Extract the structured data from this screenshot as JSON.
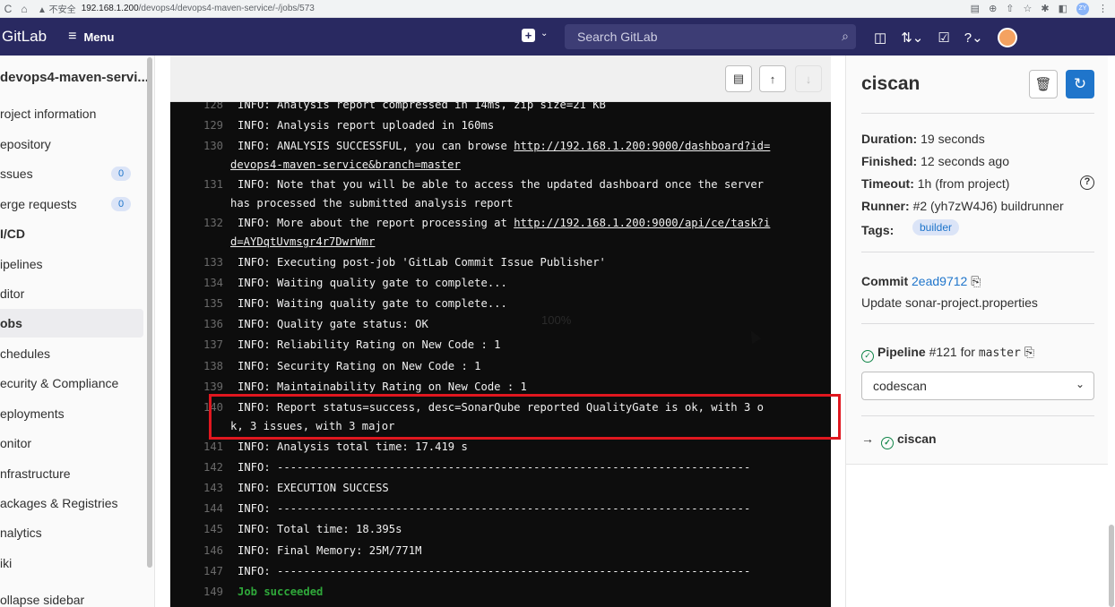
{
  "browser": {
    "nav_back": "C",
    "nav_home": "⌂",
    "security_label": "▲ 不安全",
    "url_host": "192.168.1.200",
    "url_path": "/devops4/devops4-maven-service/-/jobs/573",
    "profile": "ZY"
  },
  "topnav": {
    "brand": "GitLab",
    "menu_label": "Menu",
    "search_placeholder": "Search GitLab"
  },
  "sidebar": {
    "project": "devops4-maven-servi...",
    "items": [
      {
        "label": "roject information"
      },
      {
        "label": "epository"
      },
      {
        "label": "ssues",
        "badge": "0"
      },
      {
        "label": "erge requests",
        "badge": "0"
      },
      {
        "label": "I/CD"
      },
      {
        "label": "ipelines"
      },
      {
        "label": "ditor"
      },
      {
        "label": "obs"
      },
      {
        "label": "chedules"
      },
      {
        "label": "ecurity & Compliance"
      },
      {
        "label": "eployments"
      },
      {
        "label": "onitor"
      },
      {
        "label": "nfrastructure"
      },
      {
        "label": "ackages & Registries"
      },
      {
        "label": "nalytics"
      },
      {
        "label": "iki"
      }
    ],
    "collapse_label": "ollapse sidebar"
  },
  "log": {
    "watermark": "100%",
    "lines": [
      {
        "num": "128",
        "text": "INFO: Analysis report compressed in 14ms, zip size=21 KB"
      },
      {
        "num": "129",
        "text": "INFO: Analysis report uploaded in 160ms"
      },
      {
        "num": "130",
        "text": "INFO: ANALYSIS SUCCESSFUL, you can browse ",
        "link": "http://192.168.1.200:9000/dashboard?id=",
        "cont_link": "devops4-maven-service&branch=master"
      },
      {
        "num": "131",
        "text": "INFO: Note that you will be able to access the updated dashboard once the server",
        "cont": "has processed the submitted analysis report"
      },
      {
        "num": "132",
        "text": "INFO: More about the report processing at ",
        "link": "http://192.168.1.200:9000/api/ce/task?i",
        "cont_link": "d=AYDqtUvmsgr4r7DwrWmr"
      },
      {
        "num": "133",
        "text": "INFO: Executing post-job 'GitLab Commit Issue Publisher'"
      },
      {
        "num": "134",
        "text": "INFO: Waiting quality gate to complete..."
      },
      {
        "num": "135",
        "text": "INFO: Waiting quality gate to complete..."
      },
      {
        "num": "136",
        "text": "INFO: Quality gate status: OK"
      },
      {
        "num": "137",
        "text": "INFO: Reliability Rating on New Code : 1"
      },
      {
        "num": "138",
        "text": "INFO: Security Rating on New Code : 1"
      },
      {
        "num": "139",
        "text": "INFO: Maintainability Rating on New Code : 1"
      },
      {
        "num": "140",
        "text": "INFO: Report status=success, desc=SonarQube reported QualityGate is ok, with 3 o",
        "cont": "k, 3 issues, with 3 major"
      },
      {
        "num": "141",
        "text": "INFO: Analysis total time: 17.419 s"
      },
      {
        "num": "142",
        "text": "INFO: ------------------------------------------------------------------------"
      },
      {
        "num": "143",
        "text": "INFO: EXECUTION SUCCESS"
      },
      {
        "num": "144",
        "text": "INFO: ------------------------------------------------------------------------"
      },
      {
        "num": "145",
        "text": "INFO: Total time: 18.395s"
      },
      {
        "num": "146",
        "text": "INFO: Final Memory: 25M/771M"
      },
      {
        "num": "147",
        "text": "INFO: ------------------------------------------------------------------------"
      },
      {
        "num": "149",
        "text": "Job succeeded"
      }
    ]
  },
  "job": {
    "title": "ciscan",
    "duration_label": "Duration:",
    "duration": "19 seconds",
    "finished_label": "Finished:",
    "finished": "12 seconds ago",
    "timeout_label": "Timeout:",
    "timeout": "1h (from project)",
    "runner_label": "Runner:",
    "runner": "#2 (yh7zW4J6) buildrunner",
    "tags_label": "Tags:",
    "tag": "builder",
    "commit_label": "Commit",
    "commit_sha": "2ead9712",
    "commit_message": "Update sonar-project.properties",
    "pipeline_label": "Pipeline",
    "pipeline_id": "#121",
    "pipeline_for": "for",
    "pipeline_ref": "master",
    "stage_select": "codescan",
    "stage_job": "ciscan"
  },
  "colors": {
    "nav_bg": "#292961",
    "primary": "#1f75cb",
    "success": "#108548",
    "highlight": "#e0171f"
  }
}
